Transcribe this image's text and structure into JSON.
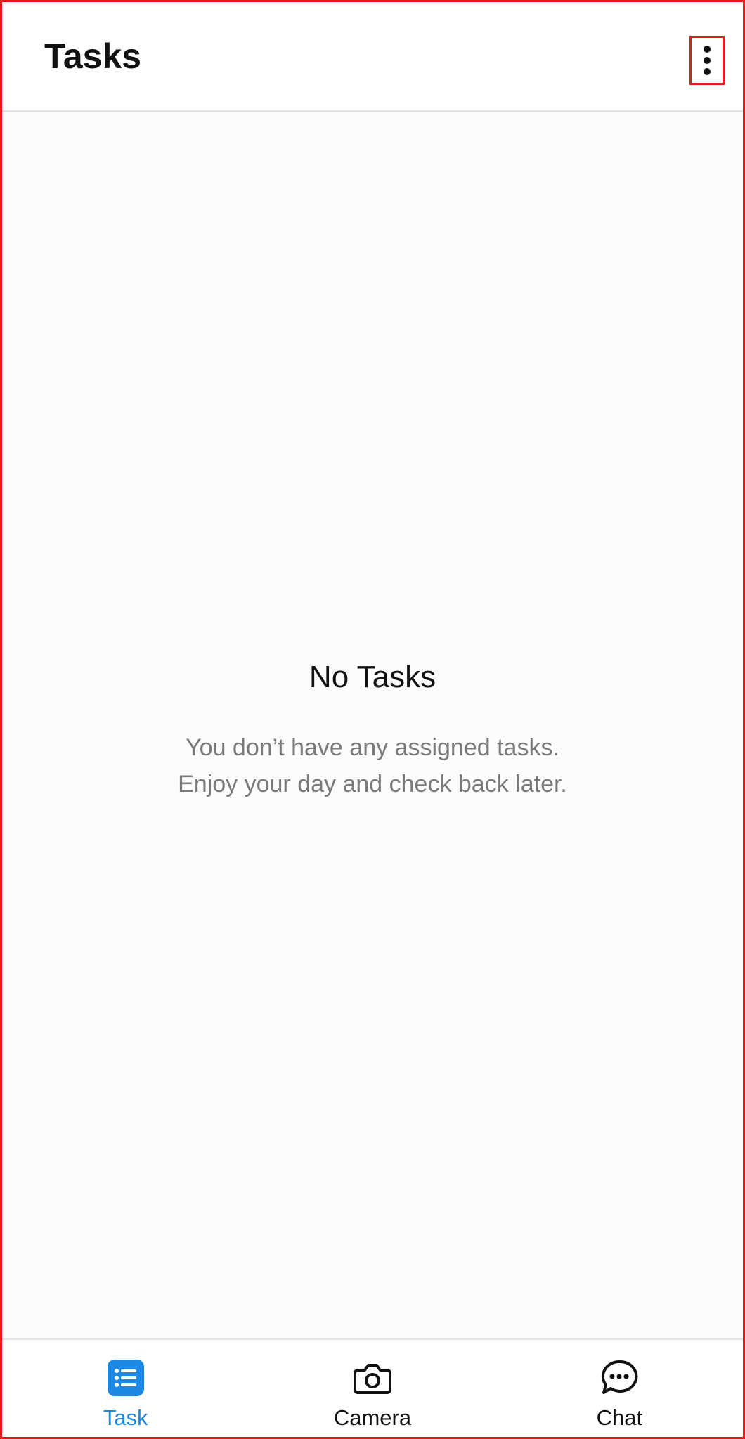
{
  "app_bar": {
    "title": "Tasks",
    "menu_icon": "more-vertical-icon"
  },
  "empty_state": {
    "title": "No Tasks",
    "message_line1": "You don’t have any assigned tasks.",
    "message_line2": "Enjoy your day and check back later."
  },
  "bottom_nav": {
    "items": [
      {
        "label": "Task",
        "icon": "task-list-icon",
        "active": true
      },
      {
        "label": "Camera",
        "icon": "camera-icon",
        "active": false
      },
      {
        "label": "Chat",
        "icon": "chat-bubble-icon",
        "active": false
      }
    ]
  },
  "colors": {
    "accent": "#1e88e5",
    "highlight_border": "#e0201c",
    "text_primary": "#111111",
    "text_secondary": "#7a7a7a"
  }
}
